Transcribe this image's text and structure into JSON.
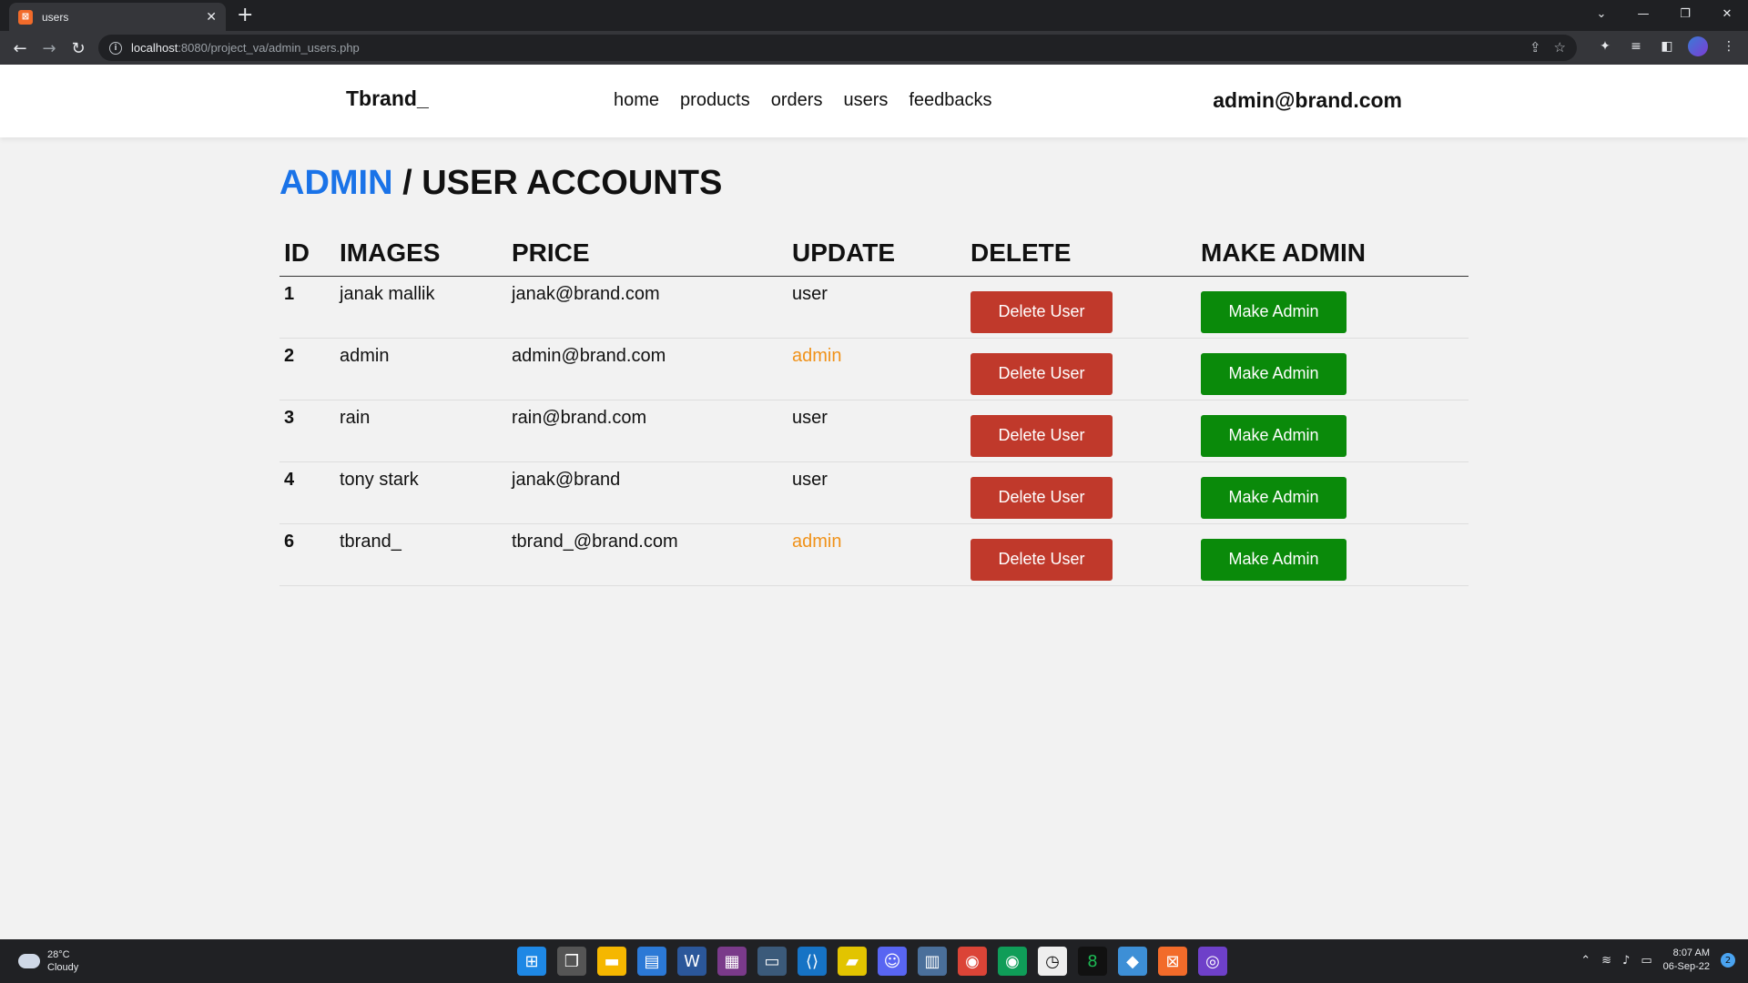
{
  "browser": {
    "tab_title": "users",
    "url_host": "localhost",
    "url_path": ":8080/project_va/admin_users.php"
  },
  "header": {
    "logo": "Tbrand_",
    "nav": [
      "home",
      "products",
      "orders",
      "users",
      "feedbacks"
    ],
    "user_email": "admin@brand.com"
  },
  "page": {
    "breadcrumb_admin": "ADMIN",
    "separator": "/",
    "title": "USER ACCOUNTS"
  },
  "table": {
    "headers": [
      "ID",
      "IMAGES",
      "PRICE",
      "UPDATE",
      "DELETE",
      "MAKE ADMIN"
    ],
    "delete_label": "Delete User",
    "make_admin_label": "Make Admin",
    "rows": [
      {
        "id": "1",
        "name": "janak mallik",
        "email": "janak@brand.com",
        "role": "user"
      },
      {
        "id": "2",
        "name": "admin",
        "email": "admin@brand.com",
        "role": "admin"
      },
      {
        "id": "3",
        "name": "rain",
        "email": "rain@brand.com",
        "role": "user"
      },
      {
        "id": "4",
        "name": "tony stark",
        "email": "janak@brand",
        "role": "user"
      },
      {
        "id": "6",
        "name": "tbrand_",
        "email": "tbrand_@brand.com",
        "role": "admin"
      }
    ]
  },
  "taskbar": {
    "temperature": "28°C",
    "weather": "Cloudy",
    "time": "8:07 AM",
    "date": "06-Sep-22",
    "notification_count": "2"
  },
  "colors": {
    "accent": "#1a73e8",
    "delete": "#c0392b",
    "make_admin": "#0a8a0a",
    "admin_role": "#f0921a"
  }
}
